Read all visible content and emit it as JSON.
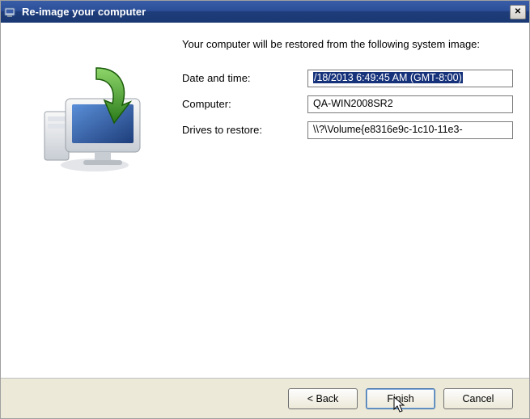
{
  "window": {
    "title": "Re-image your computer"
  },
  "intro": "Your computer will be restored from the following system image:",
  "fields": {
    "date_label": "Date and time:",
    "date_value": "/18/2013 6:49:45 AM (GMT-8:00)",
    "computer_label": "Computer:",
    "computer_value": "QA-WIN2008SR2",
    "drives_label": "Drives to restore:",
    "drives_value": "\\\\?\\Volume{e8316e9c-1c10-11e3-"
  },
  "buttons": {
    "back": "< Back",
    "finish": "Finish",
    "cancel": "Cancel"
  }
}
